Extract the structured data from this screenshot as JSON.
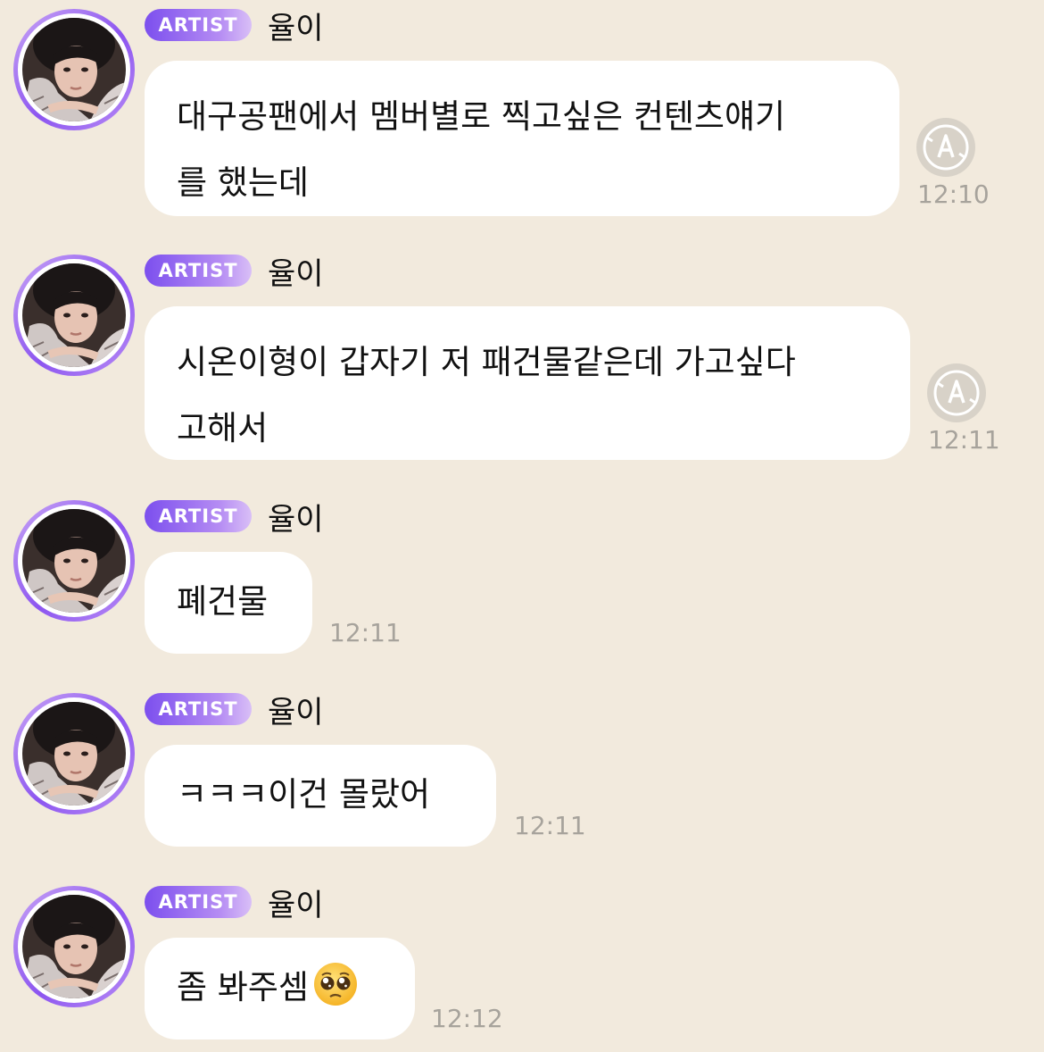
{
  "messages": [
    {
      "badge": "ARTIST",
      "name": "율이",
      "lines": [
        "대구공팬에서 멤버별로 찍고싶은 컨텐츠얘기",
        "를 했는데"
      ],
      "time": "12:10",
      "translate_icon": "translate-icon"
    },
    {
      "badge": "ARTIST",
      "name": "율이",
      "lines": [
        "시온이형이 갑자기 저 패건물같은데 가고싶다",
        "고해서"
      ],
      "time": "12:11",
      "translate_icon": "translate-icon"
    },
    {
      "badge": "ARTIST",
      "name": "율이",
      "lines": [
        "폐건물"
      ],
      "time": "12:11"
    },
    {
      "badge": "ARTIST",
      "name": "율이",
      "lines": [
        "ㅋㅋㅋ이건 몰랐어"
      ],
      "time": "12:11"
    },
    {
      "badge": "ARTIST",
      "name": "율이",
      "lines": [
        "좀 봐주셈"
      ],
      "emoji": "pleading-face-emoji",
      "time": "12:12"
    }
  ],
  "colors": {
    "background": "#f2eadd",
    "bubble": "#ffffff",
    "badge_start": "#7c4fee",
    "badge_end": "#d9bff7",
    "timestamp": "#a7a39c"
  }
}
